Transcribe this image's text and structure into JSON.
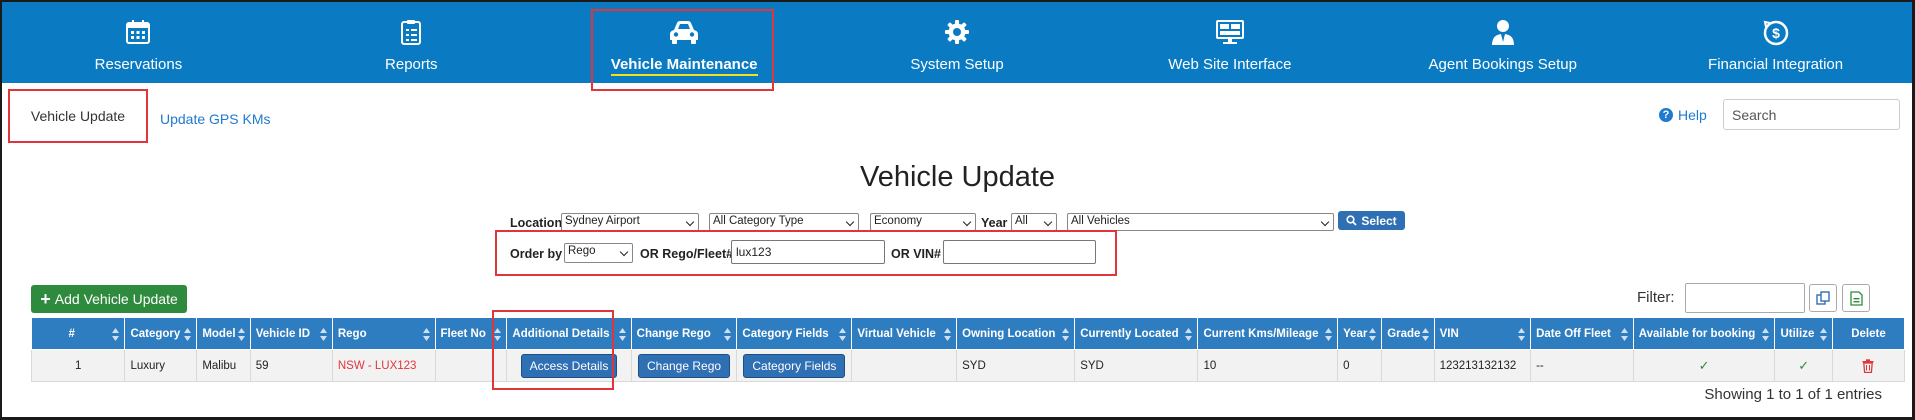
{
  "nav": {
    "items": [
      {
        "label": "Reservations",
        "icon": "calendar-icon"
      },
      {
        "label": "Reports",
        "icon": "clipboard-icon"
      },
      {
        "label": "Vehicle Maintenance",
        "icon": "car-icon",
        "active": true
      },
      {
        "label": "System Setup",
        "icon": "gear-icon"
      },
      {
        "label": "Web Site Interface",
        "icon": "monitor-icon"
      },
      {
        "label": "Agent Bookings Setup",
        "icon": "agent-icon"
      },
      {
        "label": "Financial Integration",
        "icon": "money-icon"
      }
    ]
  },
  "subnav": {
    "active_tab": "Vehicle Update",
    "link_tab": "Update GPS KMs",
    "help": "Help",
    "search_placeholder": "Search"
  },
  "page": {
    "title": "Vehicle Update"
  },
  "filters": {
    "location_label": "Location",
    "location_value": "Sydney Airport",
    "category_type_value": "All Category Type",
    "category_value": "Economy",
    "year_label": "Year",
    "year_value": "All",
    "vehicles_value": "All Vehicles",
    "select_button": "Select",
    "order_by_label": "Order by",
    "order_by_value": "Rego",
    "rego_label": "OR Rego/Fleet#",
    "rego_value": "lux123",
    "vin_label": "OR VIN#",
    "vin_value": ""
  },
  "toolbar": {
    "add_button": "Add Vehicle Update",
    "filter_label": "Filter:"
  },
  "table": {
    "headers": [
      "#",
      "Category",
      "Model",
      "Vehicle ID",
      "Rego",
      "Fleet No",
      "Additional Details",
      "Change Rego",
      "Category Fields",
      "Virtual Vehicle",
      "Owning Location",
      "Currently Located",
      "Current Kms/Mileage",
      "Year",
      "Grade",
      "VIN",
      "Date Off Fleet",
      "Available for booking",
      "Utilize",
      "Delete"
    ],
    "rows": [
      {
        "num": "1",
        "category": "Luxury",
        "model": "Malibu",
        "vehicle_id": "59",
        "rego": "NSW - LUX123",
        "fleet_no": "",
        "additional_details": "Access Details",
        "change_rego": "Change Rego",
        "category_fields": "Category Fields",
        "virtual_vehicle": "",
        "owning_location": "SYD",
        "currently_located": "SYD",
        "kms": "10",
        "year": "0",
        "grade": "",
        "vin": "123213132132",
        "date_off_fleet": "--",
        "available": "✓",
        "utilize": "✓"
      }
    ]
  },
  "footer": {
    "showing": "Showing 1 to 1 of 1 entries"
  },
  "colors": {
    "nav_bg": "#0a7bc2",
    "header_bg": "#2f7dc1",
    "highlight": "#e0363b",
    "add_button": "#2e8b3d",
    "link": "#1f7ad0"
  }
}
